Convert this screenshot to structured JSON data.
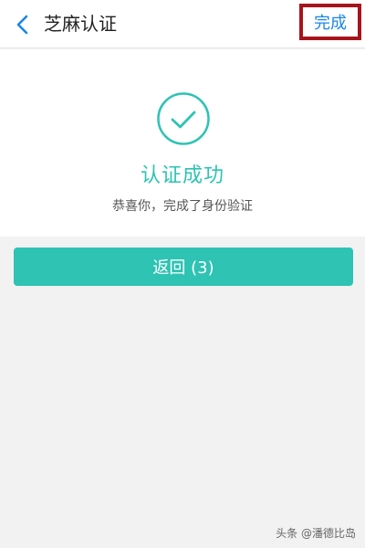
{
  "colors": {
    "accent": "#2ec3b3",
    "link_blue": "#1a87e8",
    "highlight_red": "#a8141c"
  },
  "navbar": {
    "back_icon": "chevron-left-icon",
    "title": "芝麻认证",
    "done_label": "完成"
  },
  "result": {
    "icon": "check-circle-icon",
    "title": "认证成功",
    "subtitle": "恭喜你，完成了身份验证"
  },
  "actions": {
    "return_label": "返回 (3)"
  },
  "watermark": {
    "text": "头条 @潘德比岛"
  }
}
